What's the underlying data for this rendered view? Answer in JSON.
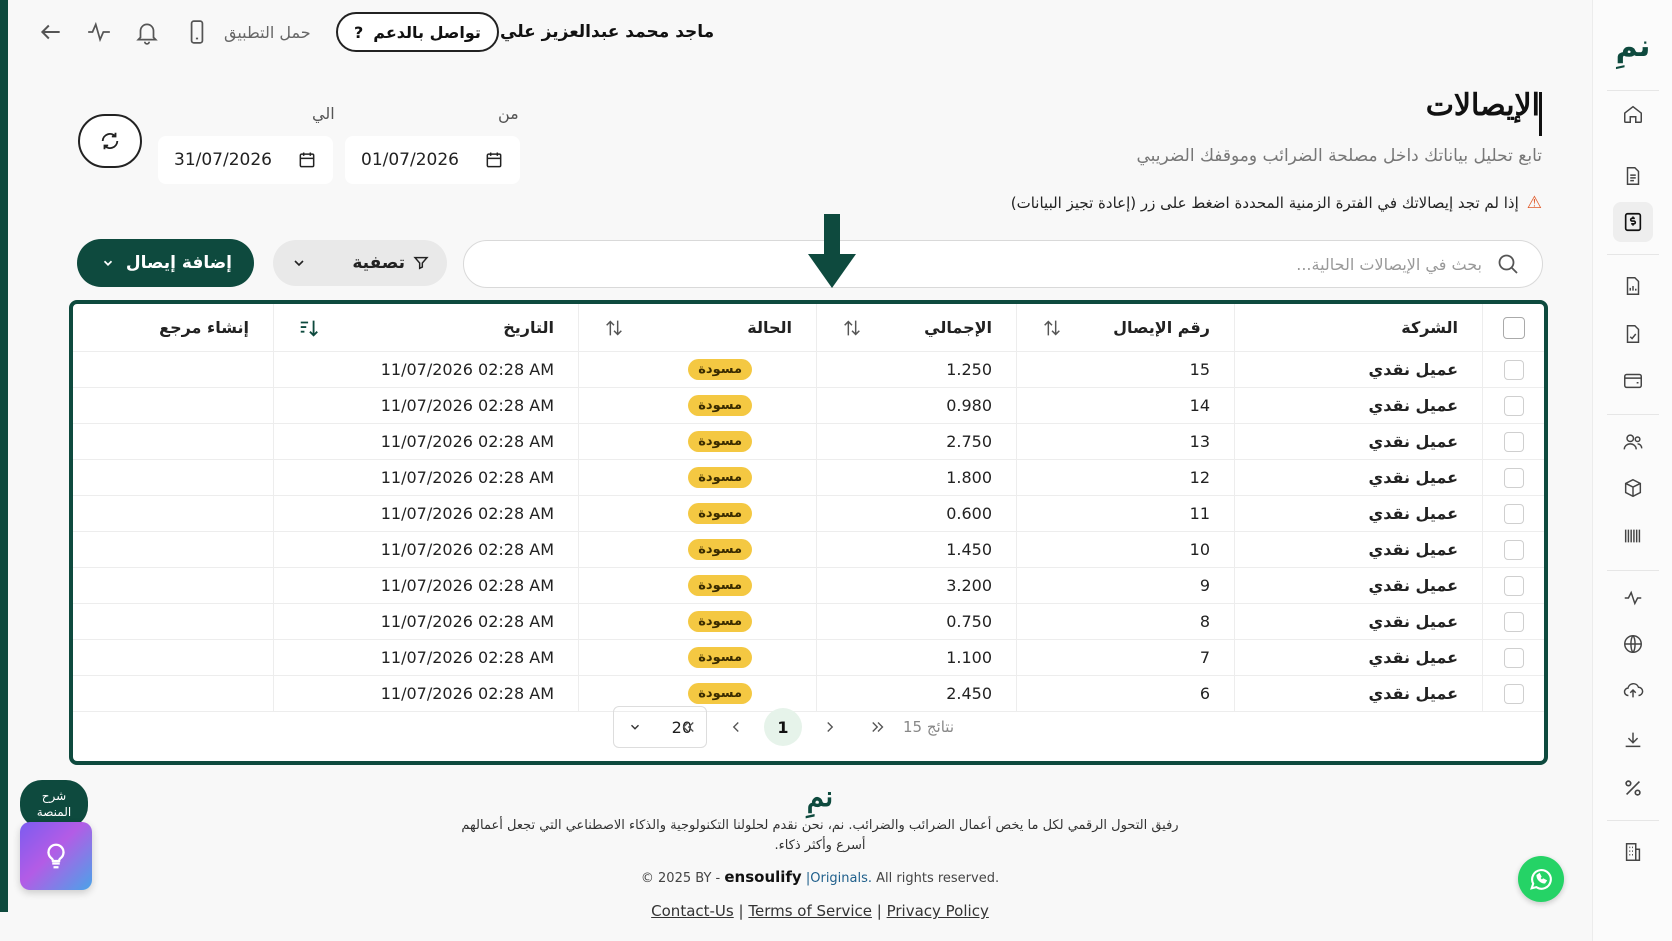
{
  "header": {
    "user_name": "ماجد محمد عبدالعزيز علي",
    "support_label": "تواصل بالدعم",
    "support_icon": "?",
    "app_label": "حمل التطبيق"
  },
  "page": {
    "title": "الإيصالات",
    "subtitle": "تابع تحليل بياناتك داخل مصلحة الضرائب وموقفك الضريبي",
    "warning": "إذا لم تجد إيصالاتك في الفترة الزمنية المحددة اضغط على زر (إعادة تجيز البيانات)"
  },
  "date_filter": {
    "from_label": "من",
    "from_value": "01/07/2026",
    "to_label": "الي",
    "to_value": "31/07/2026"
  },
  "toolbar": {
    "search_placeholder": "بحث في الإيصالات الحالية...",
    "filter_label": "تصفية",
    "add_label": "إضافة إيصال"
  },
  "table": {
    "headers": {
      "company": "الشركة",
      "receipt_no": "رقم الإيصال",
      "total": "الإجمالي",
      "status": "الحالة",
      "date": "التاريخ",
      "create_ref": "إنشاء مرجع"
    },
    "rows": [
      {
        "company": "عميل نقدي",
        "receipt_no": "15",
        "total": "1.250",
        "status": "مسودة",
        "date": "11/07/2026 02:28 AM"
      },
      {
        "company": "عميل نقدي",
        "receipt_no": "14",
        "total": "0.980",
        "status": "مسودة",
        "date": "11/07/2026 02:28 AM"
      },
      {
        "company": "عميل نقدي",
        "receipt_no": "13",
        "total": "2.750",
        "status": "مسودة",
        "date": "11/07/2026 02:28 AM"
      },
      {
        "company": "عميل نقدي",
        "receipt_no": "12",
        "total": "1.800",
        "status": "مسودة",
        "date": "11/07/2026 02:28 AM"
      },
      {
        "company": "عميل نقدي",
        "receipt_no": "11",
        "total": "0.600",
        "status": "مسودة",
        "date": "11/07/2026 02:28 AM"
      },
      {
        "company": "عميل نقدي",
        "receipt_no": "10",
        "total": "1.450",
        "status": "مسودة",
        "date": "11/07/2026 02:28 AM"
      },
      {
        "company": "عميل نقدي",
        "receipt_no": "9",
        "total": "3.200",
        "status": "مسودة",
        "date": "11/07/2026 02:28 AM"
      },
      {
        "company": "عميل نقدي",
        "receipt_no": "8",
        "total": "0.750",
        "status": "مسودة",
        "date": "11/07/2026 02:28 AM"
      },
      {
        "company": "عميل نقدي",
        "receipt_no": "7",
        "total": "1.100",
        "status": "مسودة",
        "date": "11/07/2026 02:28 AM"
      },
      {
        "company": "عميل نقدي",
        "receipt_no": "6",
        "total": "2.450",
        "status": "مسودة",
        "date": "11/07/2026 02:28 AM"
      }
    ]
  },
  "pagination": {
    "page_size": "20",
    "current_page": "1",
    "results_text": "15 نتائج"
  },
  "footer": {
    "logo_text": "نمِ",
    "tagline_1": "رفيق التحول الرقمي لكل ما يخص أعمال الضرائب والضرائب. نم، نحن نقدم لحلولنا التكنولوجية والذكاء الاصطناعي التي تجعل أعمالهم",
    "tagline_2": "أسرع وأكثر ذكاء.",
    "copyright_prefix": "© 2025 BY -",
    "brand": "ensoulify",
    "originals": "|Originals.",
    "rights": "All rights reserved.",
    "links": [
      "Contact-Us",
      "Terms of Service",
      "Privacy Policy"
    ],
    "separator": "|"
  },
  "floating": {
    "help_label": "شرح المنصة"
  },
  "sidebar": {
    "logo_text": "نمِ",
    "items": [
      "home-icon",
      "document-icon",
      "receipt-icon",
      "report-icon",
      "invoice-icon",
      "wallet-icon",
      "users-icon",
      "box-icon",
      "barcode-icon",
      "analytics-icon",
      "globe-icon",
      "cloud-upload-icon",
      "download-icon",
      "percent-icon",
      "building-icon"
    ]
  },
  "colors": {
    "brand": "#0e4a3e",
    "badge": "#f4c842",
    "warning": "#e05a2a",
    "whatsapp": "#25d366"
  }
}
